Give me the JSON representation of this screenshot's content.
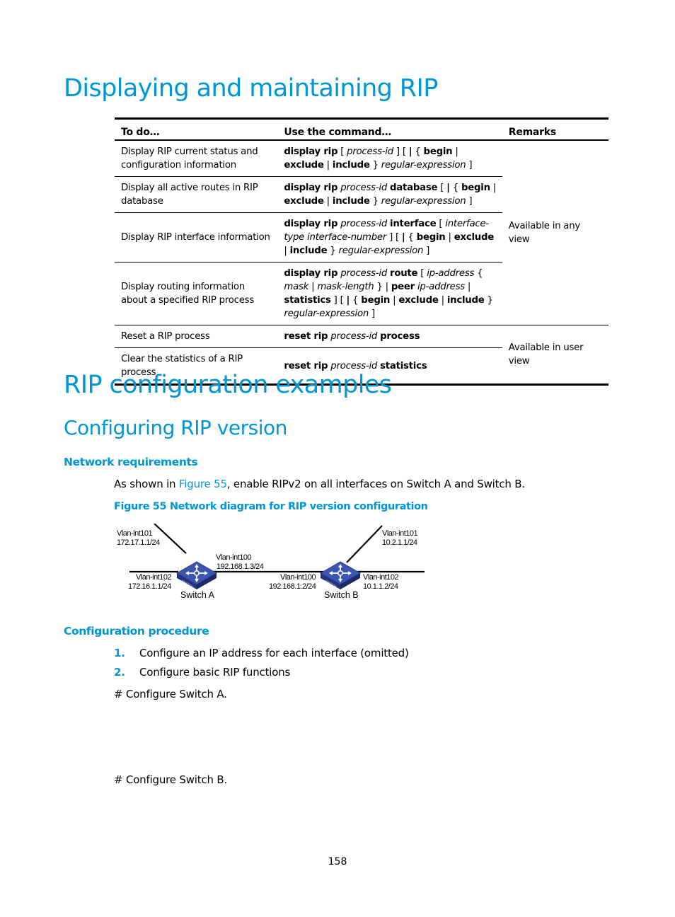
{
  "section1": {
    "title": "Displaying and maintaining RIP",
    "table": {
      "headers": [
        "To do…",
        "Use the command…",
        "Remarks"
      ],
      "rows": [
        {
          "todo": "Display RIP current status and configuration information",
          "command": [
            {
              "t": "display rip",
              "s": "b"
            },
            {
              "t": " [ ",
              "s": ""
            },
            {
              "t": "process-id",
              "s": "i"
            },
            {
              "t": " ] [ ",
              "s": ""
            },
            {
              "t": "|",
              "s": "b"
            },
            {
              "t": " { ",
              "s": ""
            },
            {
              "t": "begin",
              "s": "b"
            },
            {
              "t": " | ",
              "s": ""
            },
            {
              "t": "exclude",
              "s": "b"
            },
            {
              "t": " | ",
              "s": ""
            },
            {
              "t": "include",
              "s": "b"
            },
            {
              "t": " } ",
              "s": ""
            },
            {
              "t": "regular-expression",
              "s": "i"
            },
            {
              "t": " ]",
              "s": ""
            }
          ]
        },
        {
          "todo": "Display all active routes in RIP database",
          "command": [
            {
              "t": "display rip",
              "s": "b"
            },
            {
              "t": " ",
              "s": ""
            },
            {
              "t": "process-id",
              "s": "i"
            },
            {
              "t": " ",
              "s": ""
            },
            {
              "t": "database",
              "s": "b"
            },
            {
              "t": " [ ",
              "s": ""
            },
            {
              "t": "|",
              "s": "b"
            },
            {
              "t": " { ",
              "s": ""
            },
            {
              "t": "begin",
              "s": "b"
            },
            {
              "t": " | ",
              "s": ""
            },
            {
              "t": "exclude",
              "s": "b"
            },
            {
              "t": " | ",
              "s": ""
            },
            {
              "t": "include",
              "s": "b"
            },
            {
              "t": " } ",
              "s": ""
            },
            {
              "t": "regular-expression",
              "s": "i"
            },
            {
              "t": " ]",
              "s": ""
            }
          ]
        },
        {
          "todo": "Display RIP interface information",
          "command": [
            {
              "t": "display rip",
              "s": "b"
            },
            {
              "t": " ",
              "s": ""
            },
            {
              "t": "process-id",
              "s": "i"
            },
            {
              "t": " ",
              "s": ""
            },
            {
              "t": "interface",
              "s": "b"
            },
            {
              "t": " [ ",
              "s": ""
            },
            {
              "t": "interface-type interface-number",
              "s": "i"
            },
            {
              "t": " ] [ ",
              "s": ""
            },
            {
              "t": "|",
              "s": "b"
            },
            {
              "t": " { ",
              "s": ""
            },
            {
              "t": "begin",
              "s": "b"
            },
            {
              "t": " | ",
              "s": ""
            },
            {
              "t": "exclude",
              "s": "b"
            },
            {
              "t": " | ",
              "s": ""
            },
            {
              "t": "include",
              "s": "b"
            },
            {
              "t": " } ",
              "s": ""
            },
            {
              "t": "regular-expression",
              "s": "i"
            },
            {
              "t": " ]",
              "s": ""
            }
          ]
        },
        {
          "todo": "Display routing information about a specified RIP process",
          "command": [
            {
              "t": "display rip",
              "s": "b"
            },
            {
              "t": " ",
              "s": ""
            },
            {
              "t": "process-id",
              "s": "i"
            },
            {
              "t": " ",
              "s": ""
            },
            {
              "t": "route",
              "s": "b"
            },
            {
              "t": " [ ",
              "s": ""
            },
            {
              "t": "ip-address",
              "s": "i"
            },
            {
              "t": " { ",
              "s": ""
            },
            {
              "t": "mask",
              "s": "i"
            },
            {
              "t": " | ",
              "s": ""
            },
            {
              "t": "mask-length",
              "s": "i"
            },
            {
              "t": " } | ",
              "s": ""
            },
            {
              "t": "peer",
              "s": "b"
            },
            {
              "t": " ",
              "s": ""
            },
            {
              "t": "ip-address",
              "s": "i"
            },
            {
              "t": " | ",
              "s": ""
            },
            {
              "t": "statistics",
              "s": "b"
            },
            {
              "t": " ] [ ",
              "s": ""
            },
            {
              "t": "|",
              "s": "b"
            },
            {
              "t": " { ",
              "s": ""
            },
            {
              "t": "begin",
              "s": "b"
            },
            {
              "t": " | ",
              "s": ""
            },
            {
              "t": "exclude",
              "s": "b"
            },
            {
              "t": " | ",
              "s": ""
            },
            {
              "t": "include",
              "s": "b"
            },
            {
              "t": " } ",
              "s": ""
            },
            {
              "t": "regular-expression",
              "s": "i"
            },
            {
              "t": " ]",
              "s": ""
            }
          ]
        },
        {
          "todo": "Reset a RIP process",
          "command": [
            {
              "t": "reset rip",
              "s": "b"
            },
            {
              "t": " ",
              "s": ""
            },
            {
              "t": "process-id",
              "s": "i"
            },
            {
              "t": " ",
              "s": ""
            },
            {
              "t": "process",
              "s": "b"
            }
          ]
        },
        {
          "todo": "Clear the statistics of a RIP process",
          "command": [
            {
              "t": "reset rip",
              "s": "b"
            },
            {
              "t": " ",
              "s": ""
            },
            {
              "t": "process-id",
              "s": "i"
            },
            {
              "t": " ",
              "s": ""
            },
            {
              "t": "statistics",
              "s": "b"
            }
          ]
        }
      ],
      "remarks": {
        "any_view": "Available in any view",
        "user_view": "Available in user view"
      }
    }
  },
  "section2": {
    "title": "RIP configuration examples",
    "subsection": {
      "title": "Configuring RIP version",
      "network_requirements": {
        "heading": "Network requirements",
        "text_before": "As shown in ",
        "link": "Figure 55",
        "text_after": ", enable RIPv2 on all interfaces on Switch A and Switch B."
      },
      "figure": {
        "caption": "Figure 55 Network diagram for RIP version configuration",
        "switch_a": {
          "name": "Switch A",
          "icon_text": "SWITCH",
          "if101": {
            "name": "Vlan-int101",
            "ip": "172.17.1.1/24"
          },
          "if102": {
            "name": "Vlan-int102",
            "ip": "172.16.1.1/24"
          },
          "if100": {
            "name": "Vlan-int100",
            "ip": "192.168.1.3/24"
          }
        },
        "switch_b": {
          "name": "Switch B",
          "icon_text": "SWITCH",
          "if101": {
            "name": "Vlan-int101",
            "ip": "10.2.1.1/24"
          },
          "if100": {
            "name": "Vlan-int100",
            "ip": "192.168.1.2/24"
          },
          "if102": {
            "name": "Vlan-int102",
            "ip": "10.1.1.2/24"
          }
        }
      },
      "configuration_procedure": {
        "heading": "Configuration procedure",
        "steps": [
          {
            "num": "1.",
            "text": "Configure an IP address for each interface (omitted)"
          },
          {
            "num": "2.",
            "text": "Configure basic RIP functions"
          }
        ],
        "comment_a": "# Configure Switch A.",
        "comment_b": "# Configure Switch B."
      }
    }
  },
  "page_number": "158"
}
